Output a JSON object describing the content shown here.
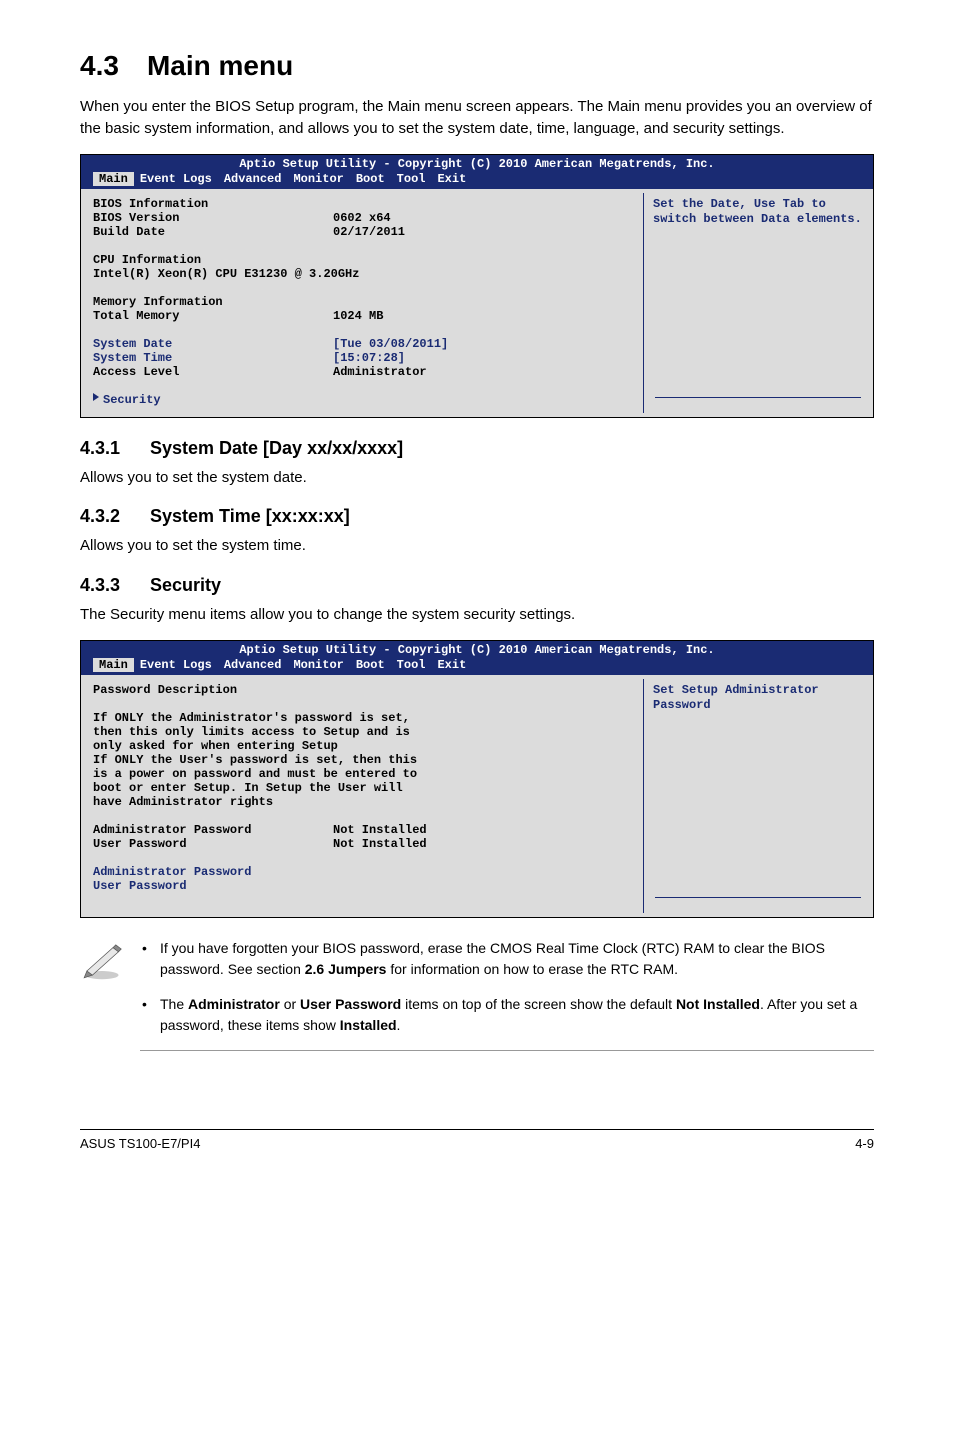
{
  "section": {
    "num": "4.3",
    "title": "Main menu",
    "intro": "When you enter the BIOS Setup program, the Main menu screen appears. The Main menu provides you an overview of the basic system information, and allows you to set the system date, time, language, and security settings."
  },
  "bios1": {
    "header": "Aptio Setup Utility - Copyright (C) 2010 American Megatrends, Inc.",
    "tabs": [
      "Main",
      "Event Logs",
      "Advanced",
      "Monitor",
      "Boot",
      "Tool",
      "Exit"
    ],
    "bios_info_h": "BIOS Information",
    "bios_version_l": "BIOS Version",
    "bios_version_v": "0602 x64",
    "build_date_l": "Build Date",
    "build_date_v": "02/17/2011",
    "cpu_info_h": "CPU Information",
    "cpu_line": "Intel(R) Xeon(R) CPU E31230 @ 3.20GHz",
    "mem_info_h": "Memory Information",
    "total_mem_l": "Total Memory",
    "total_mem_v": "1024 MB",
    "sys_date_l": "System Date",
    "sys_date_v": "[Tue 03/08/2011]",
    "sys_time_l": "System Time",
    "sys_time_v": "[15:07:28]",
    "access_l": "Access Level",
    "access_v": "Administrator",
    "security": "Security",
    "help": "Set the Date, Use Tab to switch between Data elements."
  },
  "sub1": {
    "num": "4.3.1",
    "title": "System Date [Day xx/xx/xxxx]",
    "text": "Allows you to set the system date."
  },
  "sub2": {
    "num": "4.3.2",
    "title": "System Time [xx:xx:xx]",
    "text": "Allows you to set the system time."
  },
  "sub3": {
    "num": "4.3.3",
    "title": "Security",
    "text": "The Security menu items allow you to change the system security settings."
  },
  "bios2": {
    "header": "Aptio Setup Utility - Copyright (C) 2010 American Megatrends, Inc.",
    "tabs": [
      "Main",
      "Event Logs",
      "Advanced",
      "Monitor",
      "Boot",
      "Tool",
      "Exit"
    ],
    "pwd_desc_h": "Password Description",
    "pwd_desc_body": "If ONLY the Administrator's password is set,\nthen this only limits access to Setup and is\nonly asked for when entering Setup\nIf ONLY the User's password is set, then this\nis a power on password and must be entered to\nboot or enter Setup. In Setup the User will\nhave Administrator rights",
    "admin_pw_l": "Administrator Password",
    "admin_pw_v": "Not Installed",
    "user_pw_l": "User Password",
    "user_pw_v": "Not Installed",
    "admin_pw_link": "Administrator Password",
    "user_pw_link": "User Password",
    "help": "Set Setup Administrator Password"
  },
  "notes": {
    "li1_a": "If you have forgotten your BIOS password, erase the CMOS Real Time Clock (RTC) RAM to clear the BIOS password. See section ",
    "li1_b": "2.6 Jumpers",
    "li1_c": " for information on how to erase the RTC RAM.",
    "li2_a": "The ",
    "li2_b": "Administrator",
    "li2_c": " or ",
    "li2_d": "User Password",
    "li2_e": " items on top of the screen show the default ",
    "li2_f": "Not Installed",
    "li2_g": ". After you set a password, these items show ",
    "li2_h": "Installed",
    "li2_i": "."
  },
  "footer": {
    "left": "ASUS TS100-E7/PI4",
    "right": "4-9"
  }
}
